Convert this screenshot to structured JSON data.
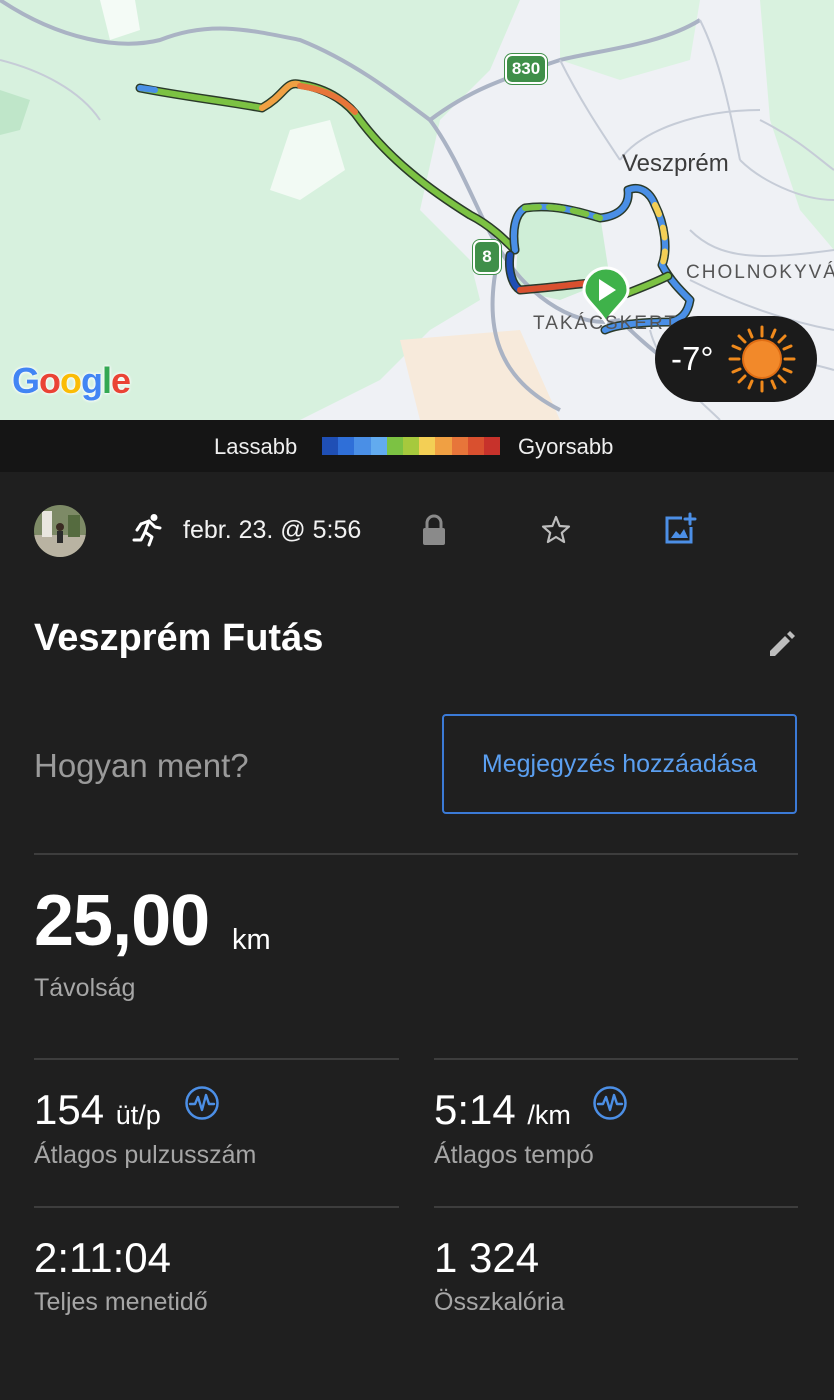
{
  "map": {
    "city_label": "Veszprém",
    "district_labels": [
      "CHOLNOKYVÁR",
      "TAKÁCSKERT"
    ],
    "road_shields": [
      "830",
      "8"
    ],
    "google_logo": "Google",
    "weather": {
      "temperature": "-7°",
      "icon": "sun-icon"
    }
  },
  "legend": {
    "slower": "Lassabb",
    "faster": "Gyorsabb",
    "colors": [
      "#1f4fb5",
      "#2f6fd8",
      "#4a8fe6",
      "#62abef",
      "#7cc243",
      "#a6c93d",
      "#f3cf55",
      "#f0a043",
      "#e7753a",
      "#d9502f",
      "#c7322b"
    ]
  },
  "meta": {
    "activity_icon": "running-icon",
    "date": "febr. 23. @ 5:56",
    "privacy_icon": "lock-icon",
    "favorite_icon": "star-icon",
    "photo_icon": "add-photo-icon"
  },
  "activity": {
    "title": "Veszprém Futás",
    "how_prompt": "Hogyan ment?",
    "add_note": "Megjegyzés hozzáadása"
  },
  "stats": {
    "distance": {
      "value": "25,00",
      "unit": "km",
      "label": "Távolság"
    },
    "avg_hr": {
      "value": "154",
      "unit": "üt/p",
      "label": "Átlagos pulzusszám"
    },
    "avg_pace": {
      "value": "5:14",
      "unit": "/km",
      "label": "Átlagos tempó"
    },
    "total_time": {
      "value": "2:11:04",
      "label": "Teljes menetidő"
    },
    "calories": {
      "value": "1 324",
      "label": "Összkalória"
    }
  },
  "accent_color": "#5b9ff0"
}
